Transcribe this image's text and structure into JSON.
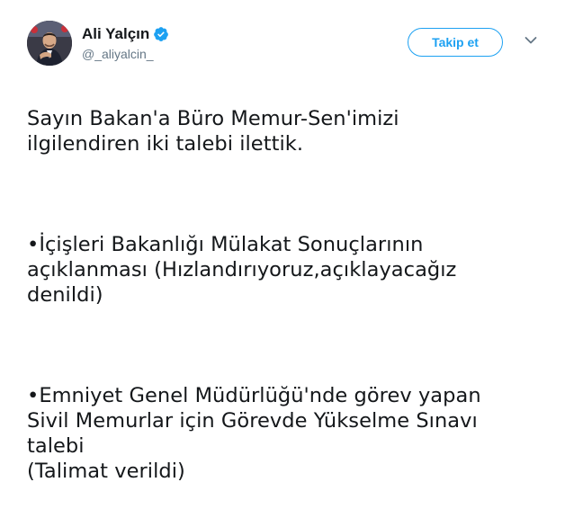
{
  "author": {
    "display_name": "Ali Yalçın",
    "handle": "@_aliyalcin_",
    "verified": true,
    "avatar_icon": "profile-photo"
  },
  "actions": {
    "follow_label": "Takip et",
    "more_icon": "chevron-down-icon"
  },
  "tweet": {
    "paragraphs": [
      "Sayın Bakan'a Büro Memur-Sen'imizi\nilgilendiren iki talebi ilettik.",
      "•İçişleri Bakanlığı Mülakat Sonuçlarının\naçıklanması (Hızlandırıyoruz,açıklayacağız\ndenildi)",
      "•Emniyet Genel Müdürlüğü'nde görev yapan\nSivil Memurlar için Görevde Yükselme Sınavı\ntalebi\n(Talimat verildi)"
    ]
  },
  "colors": {
    "accent": "#1da1f2",
    "text": "#14171a",
    "secondary_text": "#657786"
  }
}
